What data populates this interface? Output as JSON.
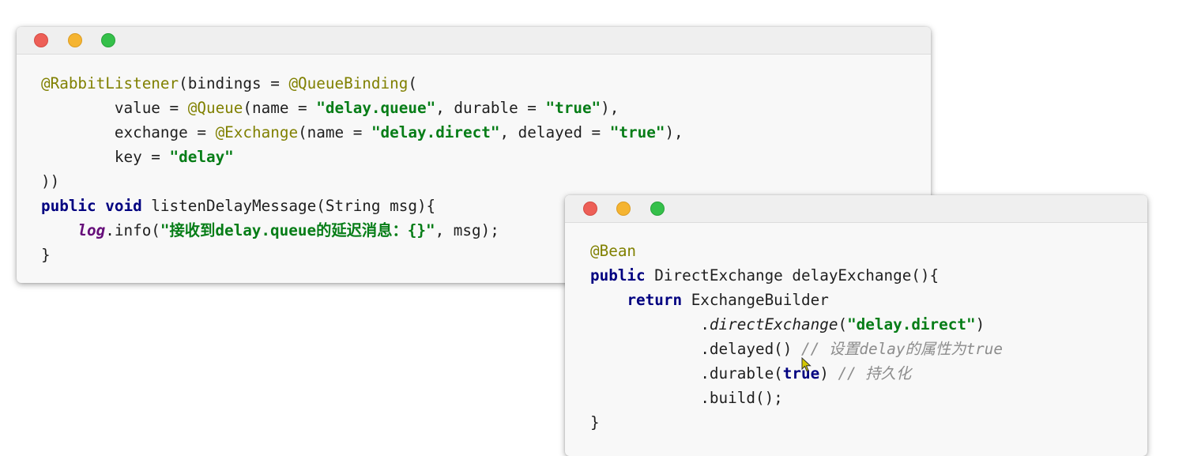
{
  "window1": {
    "line1": {
      "ann": "@RabbitListener",
      "rest": "(bindings = ",
      "ann2": "@QueueBinding",
      "end": "("
    },
    "line2": {
      "indent": "        ",
      "pre": "value = ",
      "ann": "@Queue",
      "mid": "(name = ",
      "str1": "\"delay.queue\"",
      "mid2": ", durable = ",
      "str2": "\"true\"",
      "end": "),"
    },
    "line3": {
      "indent": "        ",
      "pre": "exchange = ",
      "ann": "@Exchange",
      "mid": "(name = ",
      "str1": "\"delay.direct\"",
      "mid2": ", delayed = ",
      "str2": "\"true\"",
      "end": "),"
    },
    "line4": {
      "indent": "        ",
      "pre": "key = ",
      "str": "\"delay\""
    },
    "line5": {
      "text": "))"
    },
    "line6": {
      "kw1": "public",
      "sp": " ",
      "kw2": "void",
      "rest": " listenDelayMessage(String msg){"
    },
    "line7": {
      "indent": "    ",
      "log": "log",
      "mid": ".info(",
      "str": "\"接收到delay.queue的延迟消息：{}\"",
      "end": ", msg);"
    },
    "line8": {
      "text": "}"
    }
  },
  "window2": {
    "line1": {
      "ann": "@Bean"
    },
    "line2": {
      "kw": "public",
      "rest": " DirectExchange delayExchange(){"
    },
    "line3": {
      "indent": "    ",
      "kw": "return",
      "rest": " ExchangeBuilder"
    },
    "line4": {
      "indent": "            ",
      "dot": ".",
      "method": "directExchange",
      "open": "(",
      "str": "\"delay.direct\"",
      "close": ")"
    },
    "line5": {
      "indent": "            ",
      "code": ".delayed() ",
      "comment": "// 设置delay的属性为true"
    },
    "line6": {
      "indent": "            ",
      "pre": ".durable(",
      "kw": "true",
      "post": ") ",
      "comment": "// 持久化"
    },
    "line7": {
      "indent": "            ",
      "code": ".build();"
    },
    "line8": {
      "text": "}"
    }
  },
  "colors": {
    "annotation": "#808000",
    "keyword": "#000080",
    "string": "#067d17",
    "comment": "#8c8c8c",
    "static_field": "#660e7a",
    "close_dot": "#ed5f57",
    "minimize_dot": "#f5b431",
    "zoom_dot": "#35c04a"
  },
  "icons": [
    "close-dot-icon",
    "minimize-dot-icon",
    "zoom-dot-icon",
    "mouse-cursor-icon"
  ]
}
